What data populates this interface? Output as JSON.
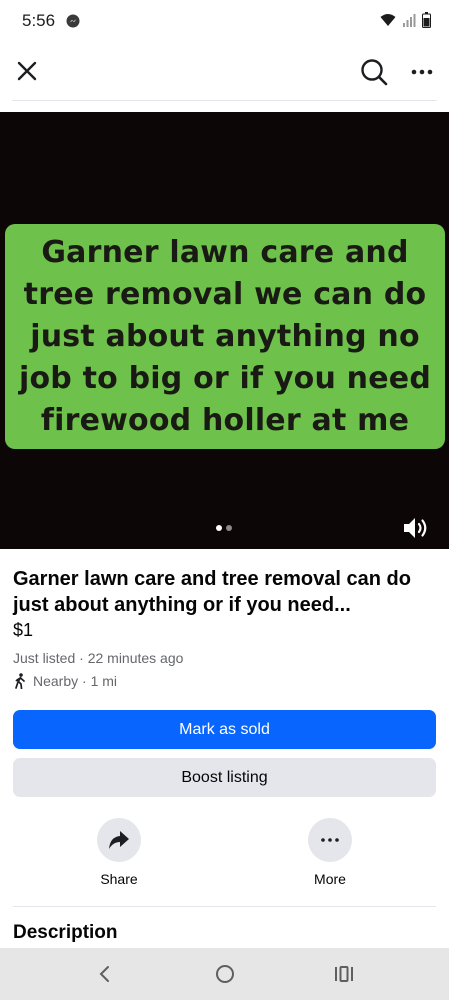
{
  "status_bar": {
    "time": "5:56"
  },
  "top_bar": {
    "close_icon": "close-icon",
    "search_icon": "search-icon",
    "more_icon": "more-horizontal-icon"
  },
  "media": {
    "banner_text": "Garner lawn care and tree removal we can do just about anything no job to big or if you need firewood holler at me",
    "banner_color": "#6ec14a",
    "background_color": "#0d0606",
    "image_count": 2,
    "current_image": 1
  },
  "listing": {
    "title": "Garner lawn care and tree removal can do just about anything or if you need...",
    "price": "$1",
    "listed_info": "Just listed · 22 minutes ago",
    "location": "Nearby · 1 mi"
  },
  "buttons": {
    "mark_sold": "Mark as sold",
    "boost": "Boost listing"
  },
  "actions": {
    "share": "Share",
    "more": "More"
  },
  "sections": {
    "description": "Description"
  },
  "colors": {
    "primary": "#0866ff",
    "secondary_bg": "#e4e6eb",
    "muted_text": "#65676b"
  }
}
